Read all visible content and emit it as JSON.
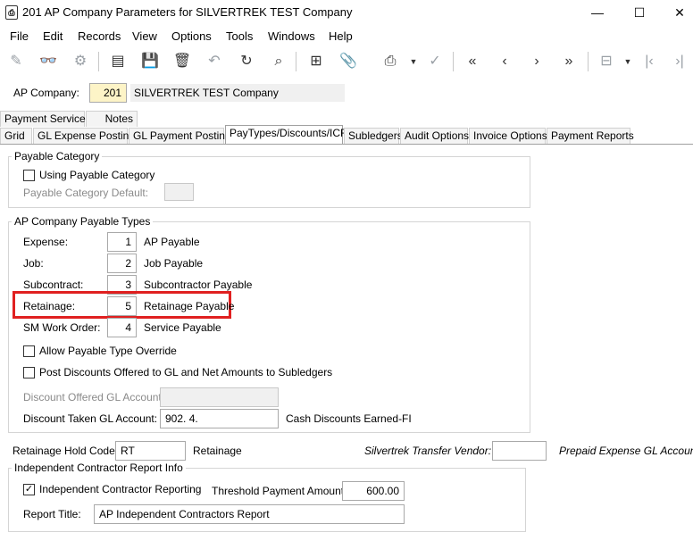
{
  "window": {
    "app_icon": "document-icon",
    "title": "201 AP Company Parameters for SILVERTREK TEST Company",
    "minimize": "—",
    "maximize": "☐",
    "close": "✕"
  },
  "menu": [
    "File",
    "Edit",
    "Records",
    "View",
    "Options",
    "Tools",
    "Windows",
    "Help"
  ],
  "header": {
    "ap_company_label": "AP Company:",
    "ap_company_value": "201",
    "company_name": "SILVERTREK TEST Company"
  },
  "tabs_row1": [
    "Payment Services",
    "Notes"
  ],
  "tabs_row2": [
    "Grid",
    "GL Expense Posting",
    "GL Payment Posting",
    "PayTypes/Discounts/ICR",
    "Subledgers",
    "Audit Options",
    "Invoice Options",
    "Payment Reports"
  ],
  "active_tab": "PayTypes/Discounts/ICR",
  "payable_category": {
    "title": "Payable Category",
    "using_label": "Using Payable Category",
    "default_label": "Payable Category Default:"
  },
  "payable_types": {
    "title": "AP Company Payable Types",
    "rows": [
      {
        "label": "Expense:",
        "value": "1",
        "desc": "AP Payable"
      },
      {
        "label": "Job:",
        "value": "2",
        "desc": "Job Payable"
      },
      {
        "label": "Subcontract:",
        "value": "3",
        "desc": "Subcontractor Payable"
      },
      {
        "label": "Retainage:",
        "value": "5",
        "desc": "Retainage Payable"
      },
      {
        "label": "SM Work Order:",
        "value": "4",
        "desc": "Service Payable"
      }
    ],
    "allow_override_label": "Allow Payable Type Override",
    "post_discounts_label": "Post Discounts Offered to GL and Net Amounts to Subledgers",
    "discount_offered_label": "Discount Offered GL Account:",
    "discount_taken_label": "Discount Taken GL Account:",
    "discount_taken_value": "902. 4.",
    "discount_taken_desc": "Cash Discounts Earned-FI"
  },
  "retainage_hold": {
    "label": "Retainage Hold Code:",
    "value": "RT",
    "desc": "Retainage"
  },
  "transfer": {
    "vendor_label": "Silvertrek Transfer Vendor:",
    "prepaid_label": "Prepaid Expense GL Account:"
  },
  "icr": {
    "title": "Independent Contractor Report Info",
    "reporting_label": "Independent Contractor Reporting",
    "reporting_checked": "✓",
    "threshold_label": "Threshold Payment Amount:",
    "threshold_value": "600.00",
    "report_title_label": "Report Title:",
    "report_title_value": "AP Independent Contractors Report"
  },
  "toolbar_icons": [
    "edit-icon",
    "binoculars-icon",
    "gear-icon",
    "new-document-icon",
    "save-icon",
    "delete-icon",
    "undo-icon",
    "refresh-icon",
    "search-icon",
    "calculator-icon",
    "attachment-icon",
    "print-icon",
    "spellcheck-icon",
    "first-record-icon",
    "previous-record-icon",
    "next-record-icon",
    "last-record-icon",
    "grid-settings-icon",
    "start-icon",
    "end-icon"
  ]
}
